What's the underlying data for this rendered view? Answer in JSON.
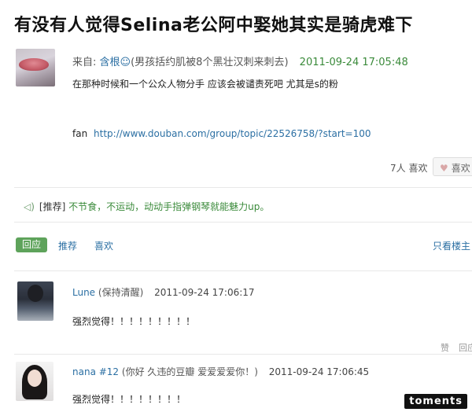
{
  "post": {
    "title": "有没有人觉得Selina老公阿中娶她其实是骑虎难下",
    "from_label": "来自:",
    "author": "含根",
    "author_mark": "☺",
    "author_sig": "(男孩括约肌被8个黑壮汉刺来刺去)",
    "time": "2011-09-24 17:05:48",
    "content": "在那种时候和一个公众人物分手 应该会被谴责死吧 尤其是s的粉",
    "fan_prefix": "fan",
    "fan_url": "http://www.douban.com/group/topic/22526758/?start=100",
    "like_count": "7人 喜欢",
    "like_button": "喜欢"
  },
  "promo": {
    "tag": "[推荐]",
    "text": "不节食，不运动，动动手指弹钢琴就能魅力up。"
  },
  "tabs": {
    "reply": "回应",
    "recommend": "推荐",
    "like": "喜欢",
    "owner_only": "只看楼主"
  },
  "comments": [
    {
      "name": "Lune",
      "sig": "(保持清醒)",
      "time": "2011-09-24 17:06:17",
      "text": "强烈觉得！！！！！！！！！",
      "actions": [
        "赞",
        "回应"
      ]
    },
    {
      "name": "nana #12",
      "sig": "(你好 久违的豆瓣 爱爱爱爱你！)",
      "time": "2011-09-24 17:06:45",
      "text": "强烈觉得！！！！！！！！"
    }
  ],
  "icons": {
    "speaker": "speaker-icon",
    "heart": "heart-icon"
  },
  "watermark": "toments",
  "colors": {
    "link": "#2b6fa3",
    "timestamp": "#3a8a3a",
    "reply_tab": "#5ea35b"
  }
}
